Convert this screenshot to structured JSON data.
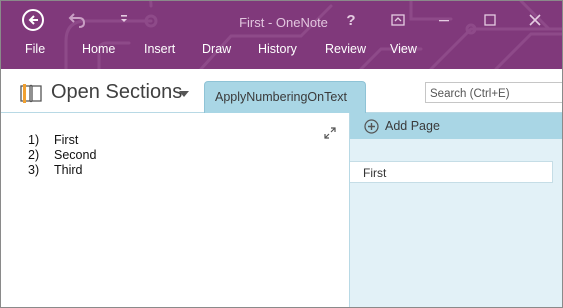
{
  "window": {
    "title": "First - OneNote",
    "help": "?",
    "colors": {
      "ribbon": "#80397b",
      "section_tab": "#a9d6e5",
      "pages_pane": "#e2f1f7"
    }
  },
  "ribbon": {
    "tabs": [
      "File",
      "Home",
      "Insert",
      "Draw",
      "History",
      "Review",
      "View"
    ]
  },
  "notebook": {
    "title": "Open Sections",
    "section_tab": "ApplyNumberingOnText"
  },
  "search": {
    "placeholder": "Search (Ctrl+E)"
  },
  "page_content": {
    "list": [
      {
        "number": "1)",
        "text": "First"
      },
      {
        "number": "2)",
        "text": "Second"
      },
      {
        "number": "3)",
        "text": "Third"
      }
    ]
  },
  "pages_pane": {
    "add_page_label": "Add Page",
    "pages": [
      "First"
    ]
  }
}
